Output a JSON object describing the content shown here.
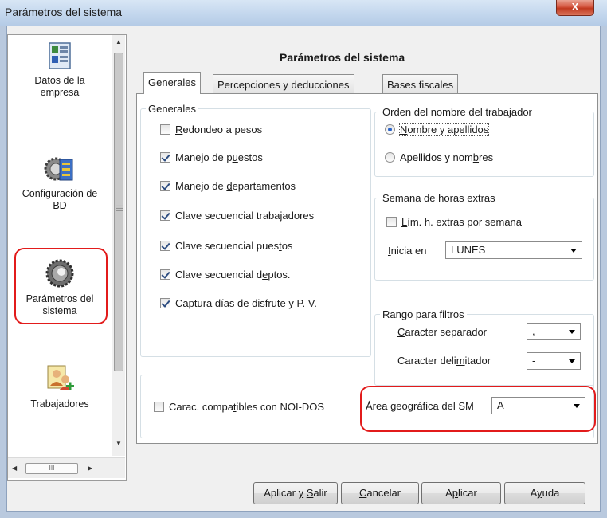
{
  "window": {
    "title": "Parámetros del sistema",
    "close_glyph": "X"
  },
  "nav": {
    "items": [
      {
        "label_line1": "Datos de la",
        "label_line2": "empresa",
        "icon": "company-data-icon"
      },
      {
        "label_line1": "Configuración de",
        "label_line2": "BD",
        "icon": "database-config-icon"
      },
      {
        "label_line1": "Parámetros del",
        "label_line2": "sistema",
        "icon": "system-parameters-icon",
        "selected": true
      },
      {
        "label_line1": "Trabajadores",
        "label_line2": "",
        "icon": "workers-icon"
      }
    ],
    "hscroll_grip": "III"
  },
  "main": {
    "title": "Parámetros del sistema",
    "tabs": [
      {
        "label": "Generales",
        "active": true
      },
      {
        "label": "Percepciones y deducciones",
        "active": false
      },
      {
        "label": "Bases fiscales",
        "active": false
      }
    ]
  },
  "generales": {
    "title": "Generales",
    "checkboxes": [
      {
        "pre": "",
        "u": "R",
        "post": "edondeo a pesos",
        "checked": false
      },
      {
        "pre": "Manejo de p",
        "u": "u",
        "post": "estos",
        "checked": true
      },
      {
        "pre": "Manejo de ",
        "u": "d",
        "post": "epartamentos",
        "checked": true
      },
      {
        "pre": "Clave secuencial trabajadores",
        "u": "",
        "post": "",
        "checked": true
      },
      {
        "pre": "Clave secuencial pues",
        "u": "t",
        "post": "os",
        "checked": true
      },
      {
        "pre": "Clave secuencial d",
        "u": "e",
        "post": "ptos.",
        "checked": true
      },
      {
        "pre": "Captura días de disfrute y  P. ",
        "u": "V",
        "post": ".",
        "checked": true
      }
    ]
  },
  "orden": {
    "title": "Orden del nombre del trabajador",
    "options": [
      {
        "pre": "",
        "u": "N",
        "post": "ombre y apellidos",
        "selected": true
      },
      {
        "pre": "Apellidos y nom",
        "u": "b",
        "post": "res",
        "selected": false
      }
    ]
  },
  "semana": {
    "title": "Semana de horas extras",
    "checkbox": {
      "pre": "",
      "u": "L",
      "post": "ím. h. extras por semana",
      "checked": false
    },
    "inicia_pre": "",
    "inicia_u": "I",
    "inicia_post": "nicia en",
    "day_value": "LUNES"
  },
  "rango": {
    "title": "Rango para filtros",
    "separador_pre": "",
    "separador_u": "C",
    "separador_post": "aracter separador",
    "separador_value": ",",
    "delimitador_pre": "Caracter deli",
    "delimitador_u": "m",
    "delimitador_post": "itador",
    "delimitador_value": "-"
  },
  "bottom": {
    "noi": {
      "pre": "Carac. compa",
      "u": "t",
      "post": "ibles con NOI-DOS",
      "checked": false
    },
    "area_label": "Área geográfica del SM",
    "area_value": "A"
  },
  "buttons": {
    "aplicar_salir": {
      "pre": "Aplicar ",
      "u": "y",
      "mid": " ",
      "u2": "S",
      "post": "alir"
    },
    "cancelar": {
      "pre": "",
      "u": "C",
      "post": "ancelar"
    },
    "aplicar": {
      "pre": "A",
      "u": "p",
      "post": "licar"
    },
    "ayuda": {
      "pre": "A",
      "u": "y",
      "post": "uda"
    }
  },
  "colors": {
    "highlight_outline": "#e21b1b",
    "checkmark": "#2c4c80",
    "radio_dot": "#2a63c9"
  }
}
